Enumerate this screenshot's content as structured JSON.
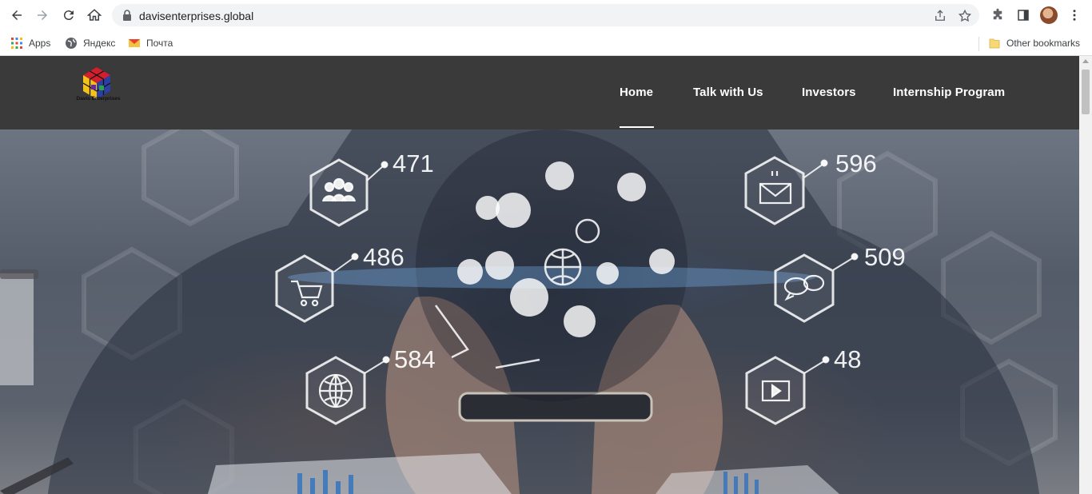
{
  "browser": {
    "url": "davisenterprises.global",
    "bookmarks": [
      {
        "label": "Apps",
        "icon": "apps-grid-icon"
      },
      {
        "label": "Яндекс",
        "icon": "globe-icon"
      },
      {
        "label": "Почта",
        "icon": "mail-icon"
      }
    ],
    "other_bookmarks": "Other bookmarks"
  },
  "site": {
    "logo_text": "Davis Enterprises",
    "nav": [
      {
        "label": "Home",
        "active": true
      },
      {
        "label": "Talk with Us",
        "active": false
      },
      {
        "label": "Investors",
        "active": false
      },
      {
        "label": "Internship Program",
        "active": false
      }
    ]
  },
  "hero": {
    "badges": [
      {
        "value": "471",
        "icon": "people-icon"
      },
      {
        "value": "486",
        "icon": "cart-icon"
      },
      {
        "value": "584",
        "icon": "globe-icon"
      },
      {
        "value": "596",
        "icon": "mail-icon"
      },
      {
        "value": "509",
        "icon": "chat-icon"
      },
      {
        "value": "48",
        "icon": "video-icon"
      }
    ]
  },
  "colors": {
    "header_bg": "#3a3a3a",
    "nav_text": "#ffffff"
  }
}
